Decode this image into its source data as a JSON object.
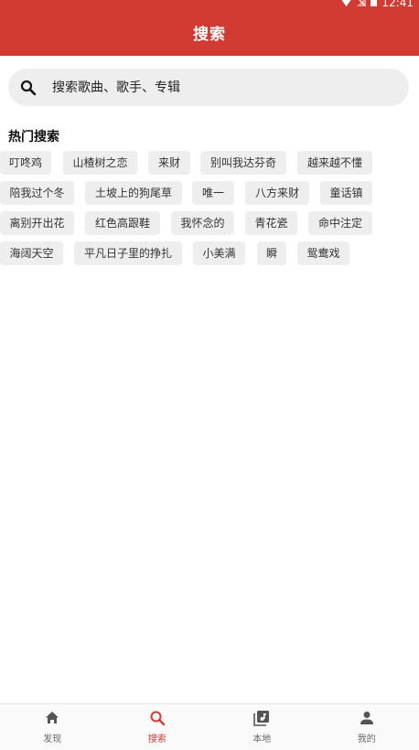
{
  "status": {
    "time": "12:41"
  },
  "appbar": {
    "title": "搜索"
  },
  "search": {
    "placeholder": "搜索歌曲、歌手、专辑",
    "value": ""
  },
  "hot": {
    "title": "热门搜索",
    "rows": [
      [
        "叮咚鸡",
        "山楂树之恋",
        "来财",
        "别叫我达芬奇",
        "越来越不懂"
      ],
      [
        "陪我过个冬",
        "土坡上的狗尾草",
        "唯一",
        "八方来财",
        "童话镇"
      ],
      [
        "离别开出花",
        "红色高跟鞋",
        "我怀念的",
        "青花瓷",
        "命中注定"
      ],
      [
        "海阔天空",
        "平凡日子里的挣扎",
        "小美满",
        "瞬",
        "鸳鸯戏"
      ]
    ]
  },
  "nav": {
    "items": [
      {
        "label": "发现",
        "icon": "home-icon"
      },
      {
        "label": "搜索",
        "icon": "search-icon"
      },
      {
        "label": "本地",
        "icon": "music-library-icon"
      },
      {
        "label": "我的",
        "icon": "person-icon"
      }
    ],
    "active": 1
  },
  "colors": {
    "accent": "#d23b32",
    "tag_bg": "#eeeeee"
  }
}
